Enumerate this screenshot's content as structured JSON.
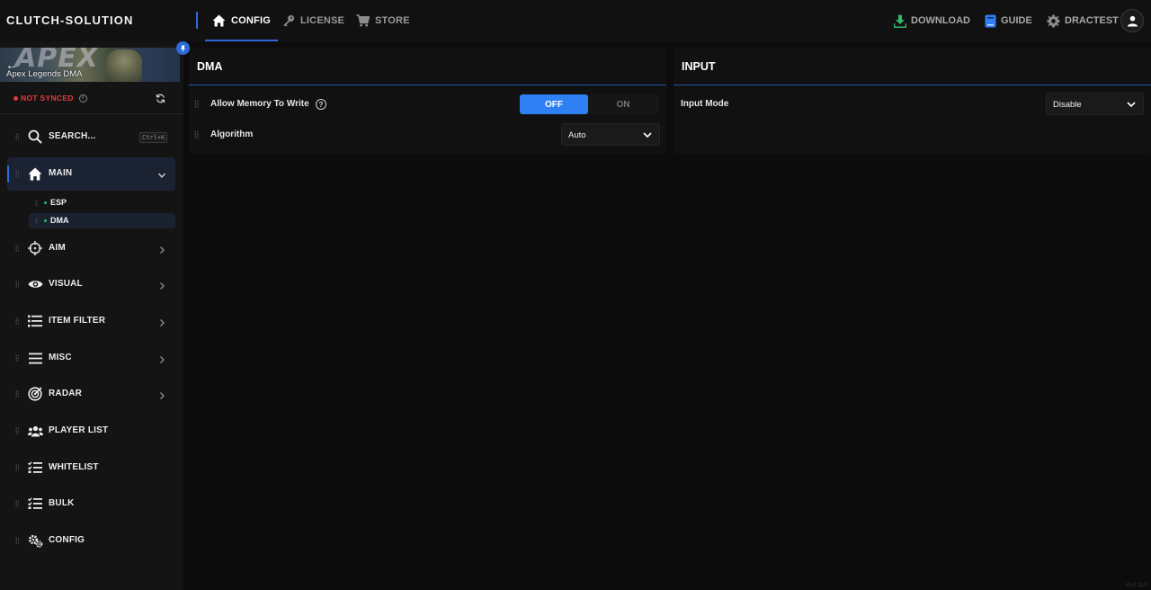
{
  "app": {
    "brand": "CLUTCH-SOLUTION",
    "version": "v3.0.113"
  },
  "topnav": {
    "tabs": [
      {
        "label": "CONFIG",
        "icon": "home-icon",
        "active": true
      },
      {
        "label": "LICENSE",
        "icon": "key-icon",
        "active": false
      },
      {
        "label": "STORE",
        "icon": "cart-icon",
        "active": false
      }
    ],
    "right": [
      {
        "label": "DOWNLOAD",
        "icon": "download-icon"
      },
      {
        "label": "GUIDE",
        "icon": "book-icon"
      },
      {
        "label": "DRACTEST",
        "icon": "gear-icon"
      }
    ]
  },
  "sidebar": {
    "game_title": "Apex Legends DMA",
    "banner_word": "APEX",
    "sync_status": "NOT SYNCED",
    "search_label": "SEARCH...",
    "search_shortcut": "Ctrl+K",
    "items": [
      {
        "label": "MAIN",
        "icon": "home-icon",
        "expanded": true
      },
      {
        "label": "AIM",
        "icon": "crosshair-icon"
      },
      {
        "label": "VISUAL",
        "icon": "eye-icon"
      },
      {
        "label": "ITEM FILTER",
        "icon": "list-icon"
      },
      {
        "label": "MISC",
        "icon": "menu-icon"
      },
      {
        "label": "RADAR",
        "icon": "radar-icon"
      },
      {
        "label": "PLAYER LIST",
        "icon": "users-icon"
      },
      {
        "label": "WHITELIST",
        "icon": "checklist-icon"
      },
      {
        "label": "BULK",
        "icon": "checklist-icon"
      },
      {
        "label": "CONFIG",
        "icon": "gears-icon"
      }
    ],
    "sub_items": [
      {
        "label": "ESP",
        "active": false
      },
      {
        "label": "DMA",
        "active": true
      }
    ]
  },
  "panels": {
    "dma": {
      "title": "DMA",
      "allow_memory_label": "Allow Memory To Write",
      "toggle_off": "OFF",
      "toggle_on": "ON",
      "toggle_value": "OFF",
      "algorithm_label": "Algorithm",
      "algorithm_value": "Auto"
    },
    "input": {
      "title": "INPUT",
      "input_mode_label": "Input Mode",
      "input_mode_value": "Disable"
    }
  },
  "colors": {
    "accent": "#2f80f2",
    "danger": "#e53b3b",
    "success": "#2fb86b",
    "download": "#2fb86b"
  }
}
